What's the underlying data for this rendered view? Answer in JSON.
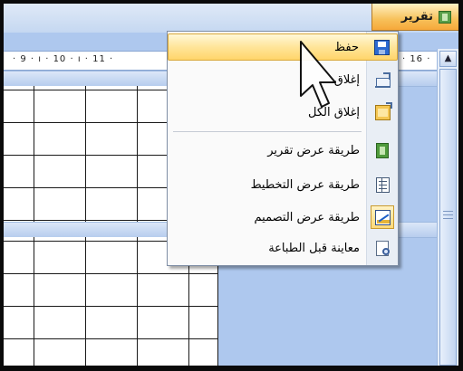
{
  "document_tab": {
    "title": "تقرير"
  },
  "ruler": {
    "left_marks": "· 9 · ı · 10 · ı · 11 ·",
    "right_marks": "ı · 16 ·"
  },
  "context_menu": {
    "items": [
      {
        "label": "حفظ",
        "icon": "save-icon",
        "active": true
      },
      {
        "label": "إغلاق",
        "icon": "close-icon"
      },
      {
        "label": "إغلاق الكل",
        "icon": "close-all-icon"
      },
      {
        "label": "طريقة عرض تقرير",
        "icon": "report-view-icon"
      },
      {
        "label": "طريقة عرض التخطيط",
        "icon": "layout-view-icon"
      },
      {
        "label": "طريقة عرض التصميم",
        "icon": "design-view-icon"
      },
      {
        "label": "معاينة قبل الطباعة",
        "icon": "print-preview-icon"
      }
    ]
  },
  "colors": {
    "tab_active": "#f7c15a",
    "menu_highlight": "#ffe59a",
    "workspace": "#aec8ee"
  }
}
